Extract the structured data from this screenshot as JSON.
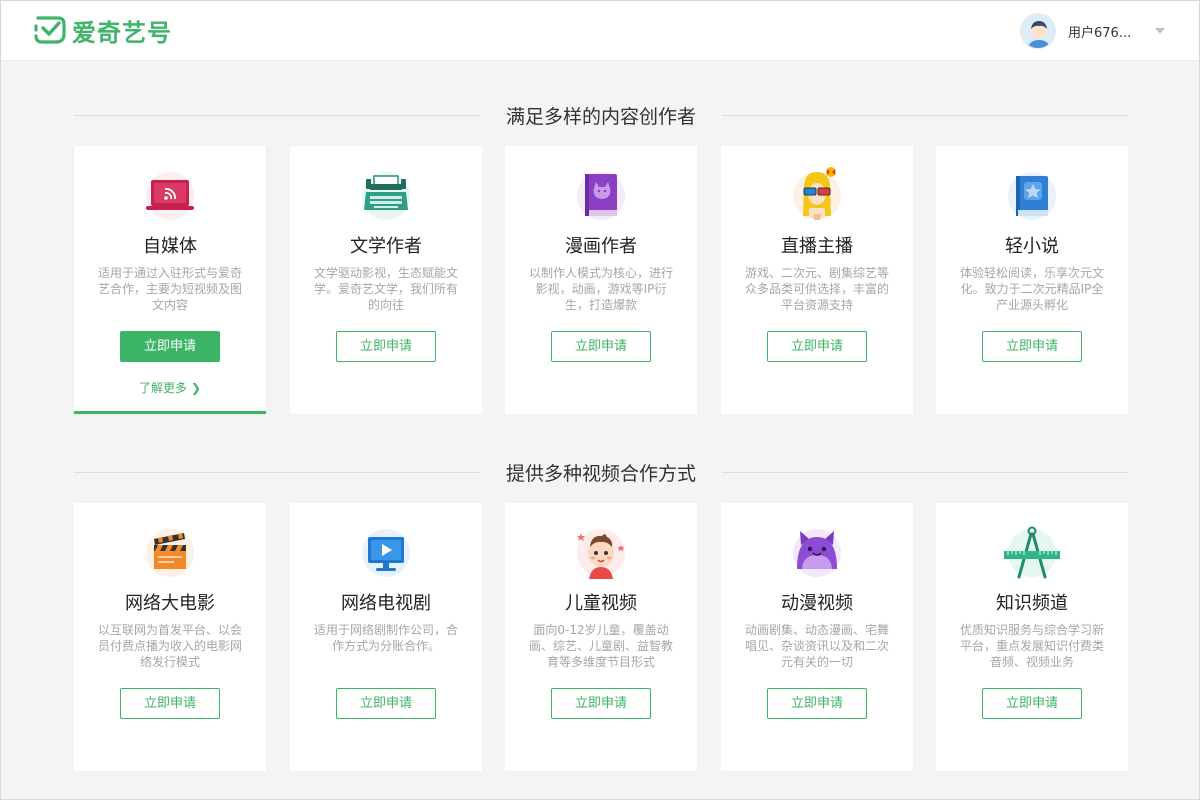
{
  "header": {
    "logo_text": "爱奇艺号",
    "username": "用户676...",
    "brand_color": "#3fb46a"
  },
  "sections": [
    {
      "title": "满足多样的内容创作者",
      "cards": [
        {
          "title": "自媒体",
          "desc": "适用于通过入驻形式与爱奇艺合作，主要为短视频及图文内容",
          "button": "立即申请",
          "learn_more": "了解更多",
          "icon": "laptop-rss-icon"
        },
        {
          "title": "文学作者",
          "desc": "文学驱动影视，生态赋能文学。爱奇艺文学，我们所有的向往",
          "button": "立即申请",
          "icon": "typewriter-icon"
        },
        {
          "title": "漫画作者",
          "desc": "以制作人模式为核心，进行影视，动画，游戏等IP衍生，打造爆款",
          "button": "立即申请",
          "icon": "comic-book-icon"
        },
        {
          "title": "直播主播",
          "desc": "游戏、二次元、剧集综艺等众多品类可供选择，丰富的平台资源支持",
          "button": "立即申请",
          "icon": "streamer-girl-icon"
        },
        {
          "title": "轻小说",
          "desc": "体验轻松阅读，乐享次元文化。致力于二次元精品IP全产业源头孵化",
          "button": "立即申请",
          "icon": "star-book-icon"
        }
      ]
    },
    {
      "title": "提供多种视频合作方式",
      "cards": [
        {
          "title": "网络大电影",
          "desc": "以互联网为首发平台、以会员付费点播为收入的电影网络发行模式",
          "button": "立即申请",
          "icon": "clapperboard-icon"
        },
        {
          "title": "网络电视剧",
          "desc": "适用于网络剧制作公司，合作方式为分账合作。",
          "button": "立即申请",
          "icon": "tv-play-icon"
        },
        {
          "title": "儿童视频",
          "desc": "面向0-12岁儿童，覆盖动画、综艺、儿童剧、益智教育等多维度节目形式",
          "button": "立即申请",
          "icon": "child-face-icon"
        },
        {
          "title": "动漫视频",
          "desc": "动画剧集、动态漫画、宅舞唱见、杂谈资讯以及和二次元有关的一切",
          "button": "立即申请",
          "icon": "purple-monster-icon"
        },
        {
          "title": "知识频道",
          "desc": "优质知识服务与综合学习新平台，重点发展知识付费类音频、视频业务",
          "button": "立即申请",
          "icon": "compass-ruler-icon"
        }
      ]
    }
  ]
}
